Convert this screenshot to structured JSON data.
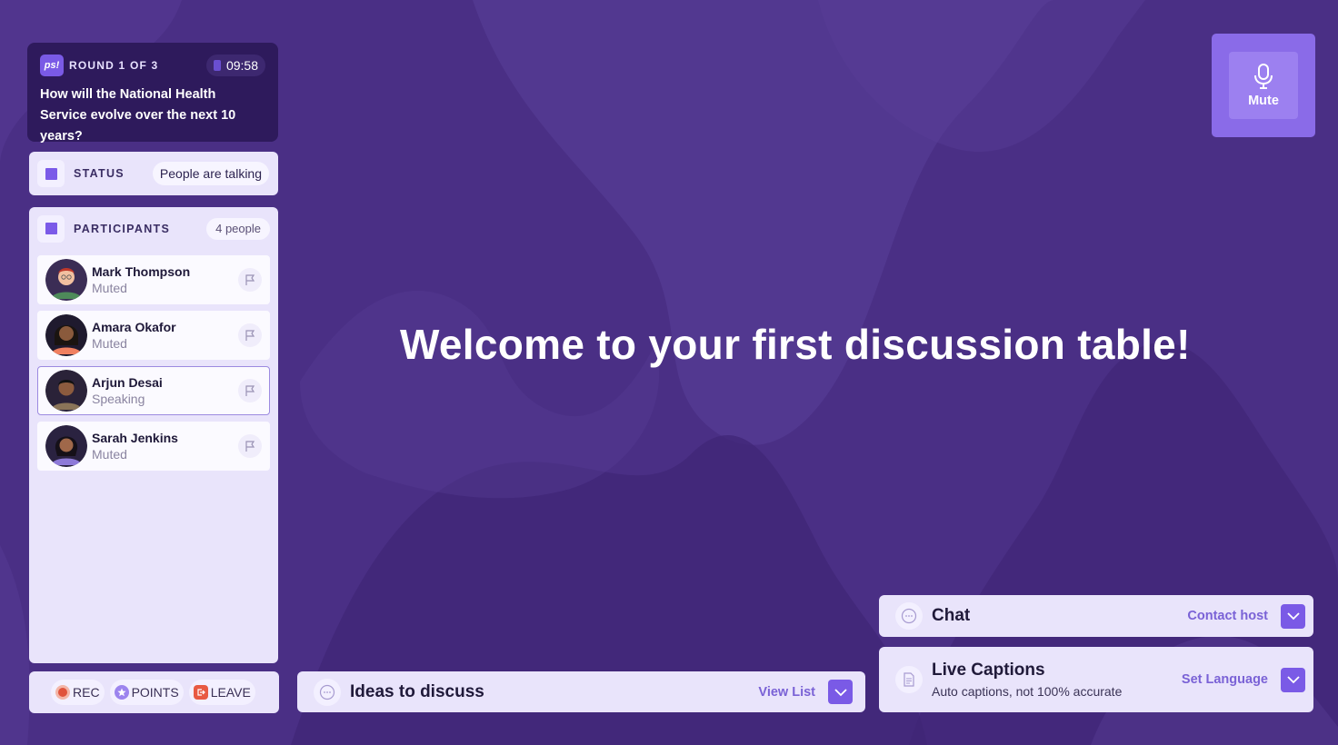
{
  "round": {
    "logo_text": "ps!",
    "label": "ROUND 1 OF 3",
    "timer": "09:58",
    "question": "How will the National Health Service evolve over the next 10 years?"
  },
  "status": {
    "label": "STATUS",
    "value": "People are talking"
  },
  "participants": {
    "label": "PARTICIPANTS",
    "count": "4 people",
    "items": [
      {
        "name": "Mark Thompson",
        "state": "Muted",
        "speaking": false
      },
      {
        "name": "Amara Okafor",
        "state": "Muted",
        "speaking": false
      },
      {
        "name": "Arjun Desai",
        "state": "Speaking",
        "speaking": true
      },
      {
        "name": "Sarah Jenkins",
        "state": "Muted",
        "speaking": false
      }
    ]
  },
  "controls": {
    "rec": "REC",
    "points": "POINTS",
    "leave": "LEAVE"
  },
  "mute": {
    "label": "Mute",
    "icon": "microphone-icon"
  },
  "welcome": "Welcome to your first discussion table!",
  "ideas": {
    "title": "Ideas to discuss",
    "link": "View List"
  },
  "chat": {
    "title": "Chat",
    "link": "Contact host"
  },
  "captions": {
    "title": "Live Captions",
    "subtitle": "Auto captions, not 100% accurate",
    "link": "Set Language"
  },
  "colors": {
    "background": "#4a2f85",
    "accent": "#7a5ae6",
    "panel": "#e9e4fb",
    "round_card": "#2e1a5c"
  }
}
